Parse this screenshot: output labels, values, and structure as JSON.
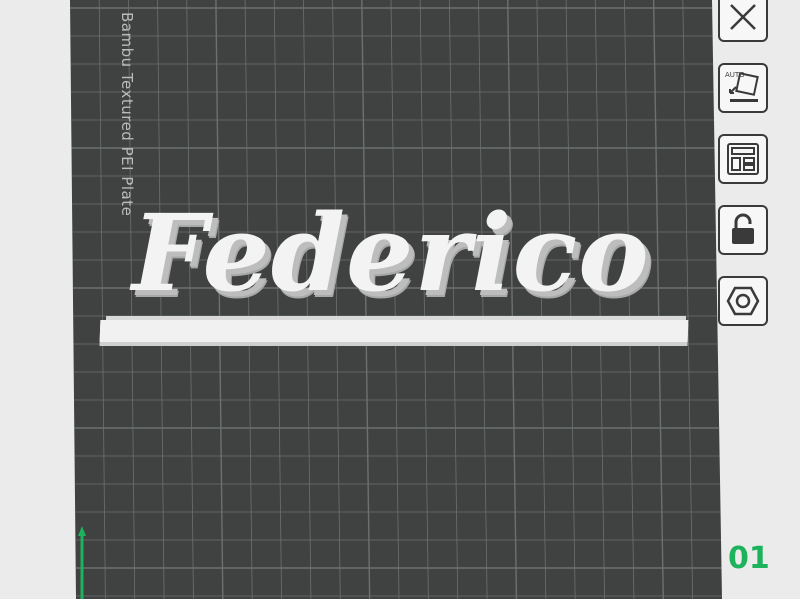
{
  "plate": {
    "label": "Bambu Textured PEI Plate",
    "index": "01"
  },
  "model": {
    "text": "Federico"
  },
  "toolbar": {
    "tools": [
      {
        "name": "close-plate",
        "icon": "x-icon"
      },
      {
        "name": "auto-orient",
        "icon": "auto-orient-icon",
        "badge": "AUTO"
      },
      {
        "name": "arrange",
        "icon": "arrange-icon"
      },
      {
        "name": "lock-plate",
        "icon": "unlock-icon"
      },
      {
        "name": "plate-settings",
        "icon": "hex-nut-icon"
      }
    ]
  },
  "colors": {
    "background": "#ebebeb",
    "plate": "#3f4241",
    "grid_line": "#6c706e",
    "axis_y": "#1db35c",
    "plate_index": "#1db35c",
    "model": "#f3f3f3"
  }
}
